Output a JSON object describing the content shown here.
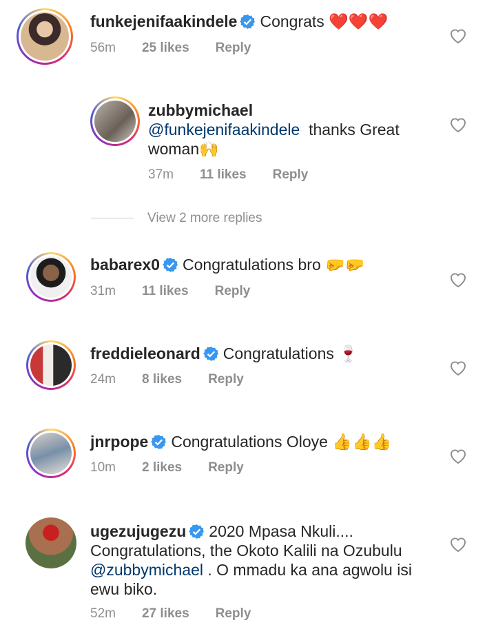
{
  "comments": [
    {
      "username": "funkejenifaakindele",
      "verified": true,
      "text": "Congrats",
      "emoji": "❤️❤️❤️",
      "time": "56m",
      "likes": "25 likes",
      "reply": "Reply",
      "avatar_color": "#c8a07c"
    },
    {
      "username": "zubbymichael",
      "verified": false,
      "mention": "@funkejenifaakindele",
      "text": "thanks Great woman",
      "emoji": "🙌",
      "time": "37m",
      "likes": "11 likes",
      "reply": "Reply",
      "avatar_color": "#9a8f86"
    },
    {
      "username": "babarex0",
      "verified": true,
      "text": "Congratulations bro",
      "emoji": "🤛🤛",
      "time": "31m",
      "likes": "11 likes",
      "reply": "Reply",
      "avatar_color": "#3a3a3a"
    },
    {
      "username": "freddieleonard",
      "verified": true,
      "text": "Congratulations",
      "emoji": "🍷",
      "time": "24m",
      "likes": "8 likes",
      "reply": "Reply",
      "avatar_color": "#7a4a3a"
    },
    {
      "username": "jnrpope",
      "verified": true,
      "text": "Congratulations Oloye",
      "emoji": "👍👍👍",
      "time": "10m",
      "likes": "2 likes",
      "reply": "Reply",
      "avatar_color": "#8aa0b8"
    },
    {
      "username": "ugezujugezu",
      "verified": true,
      "text_1": "2020 Mpasa Nkuli.... Congratulations, the Okoto Kalili na Ozubulu",
      "mention": "@zubbymichael",
      "text_2": ". O mmadu ka ana agwolu isi ewu biko.",
      "time": "52m",
      "likes": "27 likes",
      "reply": "Reply",
      "avatar_color": "#b0825a"
    }
  ],
  "view_more_replies": "View 2 more replies",
  "colors": {
    "verified": "#3897f0",
    "mention": "#00376b",
    "meta": "#8e8e8e"
  }
}
